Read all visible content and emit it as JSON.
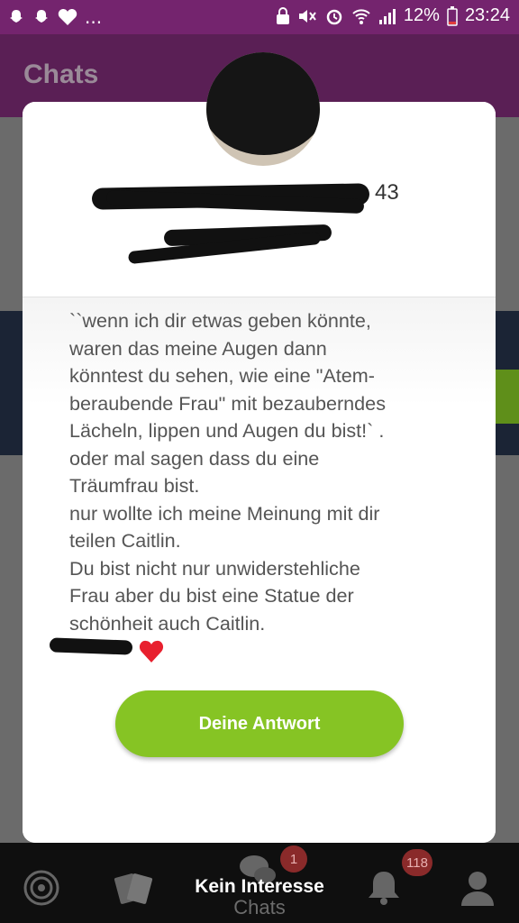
{
  "status_bar": {
    "notification_more": "...",
    "battery_percent": "12%",
    "time": "23:24"
  },
  "app_bar": {
    "title": "Chats"
  },
  "dialog": {
    "age": "43",
    "message": "``wenn ich dir etwas geben könnte,\nwaren das meine Augen dann\nkönntest du sehen, wie eine \"Atem-\nberaubende Frau\" mit bezauberndes\nLächeln, lippen und Augen du bist!` .\noder mal sagen dass du eine\nTräumfrau bist.\nnur wollte ich meine Meinung mit dir\nteilen Caitlin.\nDu bist nicht nur unwiderstehliche\nFrau aber du bist eine Statue der\nschönheit auch Caitlin.",
    "reply_button": "Deine Antwort"
  },
  "bottom_nav": {
    "chat_badge": "1",
    "notifications_badge": "118",
    "toast": "Kein Interesse",
    "chats_label": "Chats"
  },
  "colors": {
    "status_bar": "#74246e",
    "app_bar": "#5a1f55",
    "reply_button": "#86c424",
    "heart": "#e8202e"
  }
}
